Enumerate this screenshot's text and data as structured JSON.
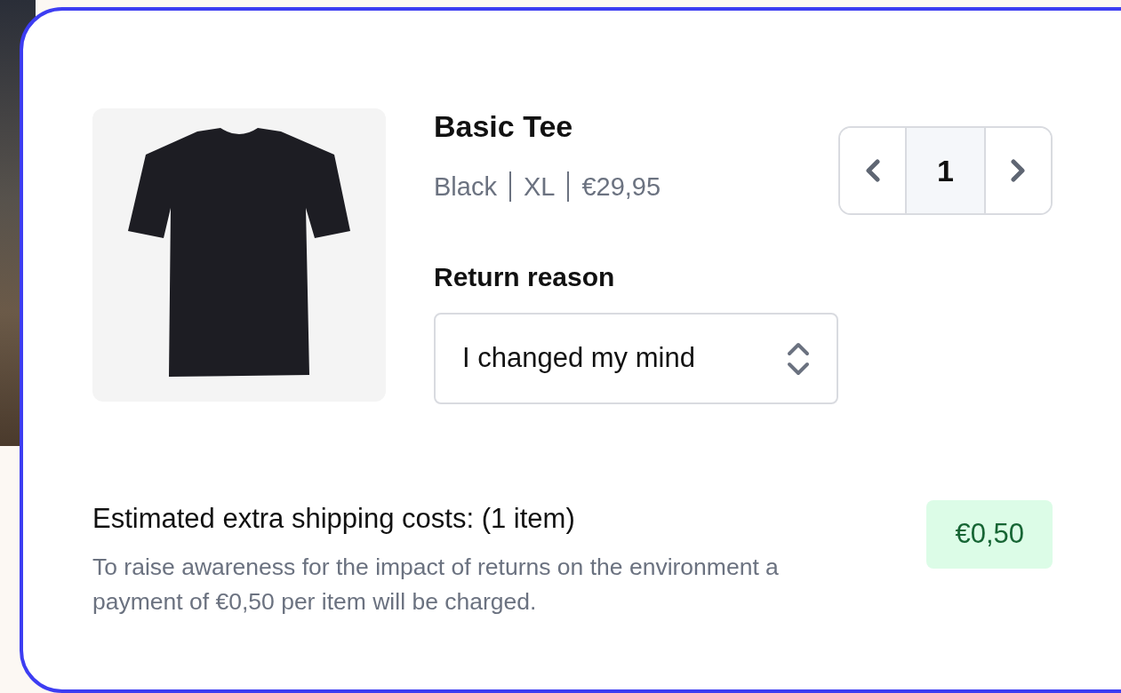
{
  "product": {
    "name": "Basic Tee",
    "colour_name": "Black",
    "size": "XL",
    "price": "€29,95"
  },
  "quantity": {
    "value": "1"
  },
  "return_reason": {
    "label": "Return reason",
    "value": "I changed my mind"
  },
  "shipping": {
    "title": "Estimated extra shipping costs: (1 item)",
    "description": "To raise awareness for the impact of returns on the environment a payment of €0,50 per item will be charged.",
    "amount": "€0,50"
  }
}
